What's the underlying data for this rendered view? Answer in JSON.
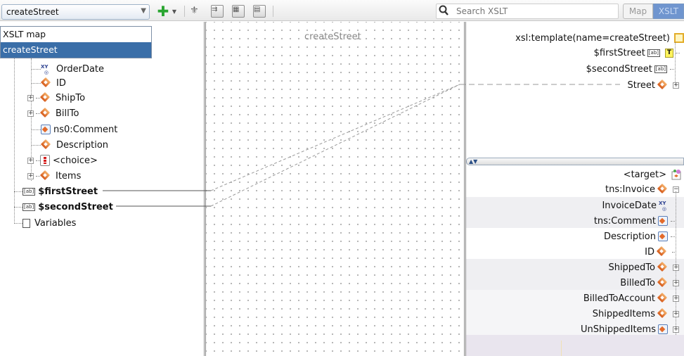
{
  "toolbar": {
    "template_selector_value": "createStreet",
    "search_placeholder": "Search XSLT",
    "tabs": {
      "map": "Map",
      "xslt": "XSLT"
    }
  },
  "dropdown": {
    "options": [
      "XSLT map",
      "createStreet"
    ],
    "selected": "createStreet"
  },
  "source_tree": {
    "items": [
      {
        "label": "OrderDate",
        "icon": "xy-date-icon"
      },
      {
        "label": "ID",
        "icon": "element-icon"
      },
      {
        "label": "ShipTo",
        "icon": "element-icon",
        "expandable": true
      },
      {
        "label": "BillTo",
        "icon": "element-icon",
        "expandable": true
      },
      {
        "label": "ns0:Comment",
        "icon": "attribute-icon"
      },
      {
        "label": "Description",
        "icon": "element-icon"
      },
      {
        "label": "<choice>",
        "icon": "choice-icon",
        "expandable": true
      },
      {
        "label": "Items",
        "icon": "element-icon",
        "expandable": true
      },
      {
        "label": "$firstStreet",
        "icon": "ab-param-icon"
      },
      {
        "label": "$secondStreet",
        "icon": "ab-param-icon"
      },
      {
        "label": "Variables",
        "icon": "document-icon"
      }
    ]
  },
  "canvas": {
    "title": "createStreet"
  },
  "template_tree": {
    "items": [
      {
        "label": "xsl:template(name=createStreet)"
      },
      {
        "label": "$firstStreet"
      },
      {
        "label": "$secondStreet"
      },
      {
        "label": "Street"
      }
    ]
  },
  "target_tree": {
    "items": [
      {
        "label": "<target>"
      },
      {
        "label": "tns:Invoice"
      },
      {
        "label": "InvoiceDate"
      },
      {
        "label": "tns:Comment"
      },
      {
        "label": "Description"
      },
      {
        "label": "ID"
      },
      {
        "label": "ShippedTo"
      },
      {
        "label": "BilledTo"
      },
      {
        "label": "BilledToAccount"
      },
      {
        "label": "ShippedItems"
      },
      {
        "label": "UnShippedItems"
      }
    ]
  },
  "colors": {
    "accent": "#3a6ea8",
    "tab_active": "#6f95cf",
    "element_icon": "#e36a2a",
    "add_icon": "#2aa531"
  }
}
